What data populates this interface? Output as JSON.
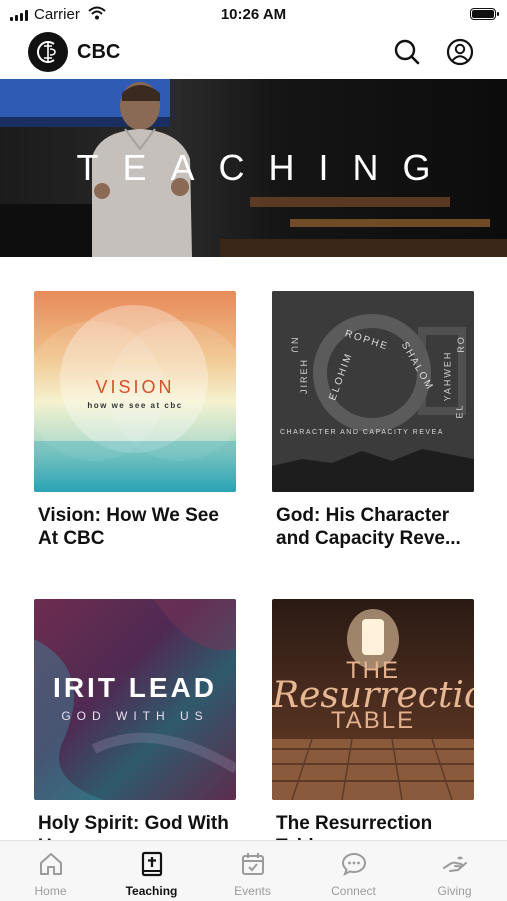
{
  "status": {
    "carrier": "Carrier",
    "time": "10:26 AM"
  },
  "header": {
    "brand": "CBC"
  },
  "hero": {
    "title": "TEACHING"
  },
  "cards": [
    {
      "title": "Vision: How We See At CBC",
      "art_title": "VISION",
      "art_subtitle": "how we see at cbc"
    },
    {
      "title": "God: His Character and Capacity Reve...",
      "art_words": [
        "ROPHE",
        "SHALOM",
        "ELOHIM",
        "JIREH",
        "YAHWEH",
        "NU",
        "RO",
        "EL"
      ],
      "art_caption": "CHARACTER AND CAPACITY REVEA"
    },
    {
      "title": "Holy Spirit: God With Us",
      "art_title": "IRIT LEAD",
      "art_subtitle": "GOD WITH US"
    },
    {
      "title": "The Resurrection Table",
      "art_title_top": "THE",
      "art_script": "Resurrectio",
      "art_title_bottom": "TABLE"
    }
  ],
  "tabs": [
    {
      "label": "Home",
      "icon": "home-icon"
    },
    {
      "label": "Teaching",
      "icon": "bible-icon"
    },
    {
      "label": "Events",
      "icon": "calendar-icon"
    },
    {
      "label": "Connect",
      "icon": "chat-icon"
    },
    {
      "label": "Giving",
      "icon": "giving-icon"
    }
  ],
  "colors": {
    "active_tab": "#111111",
    "inactive_tab": "#9b9b9b"
  }
}
